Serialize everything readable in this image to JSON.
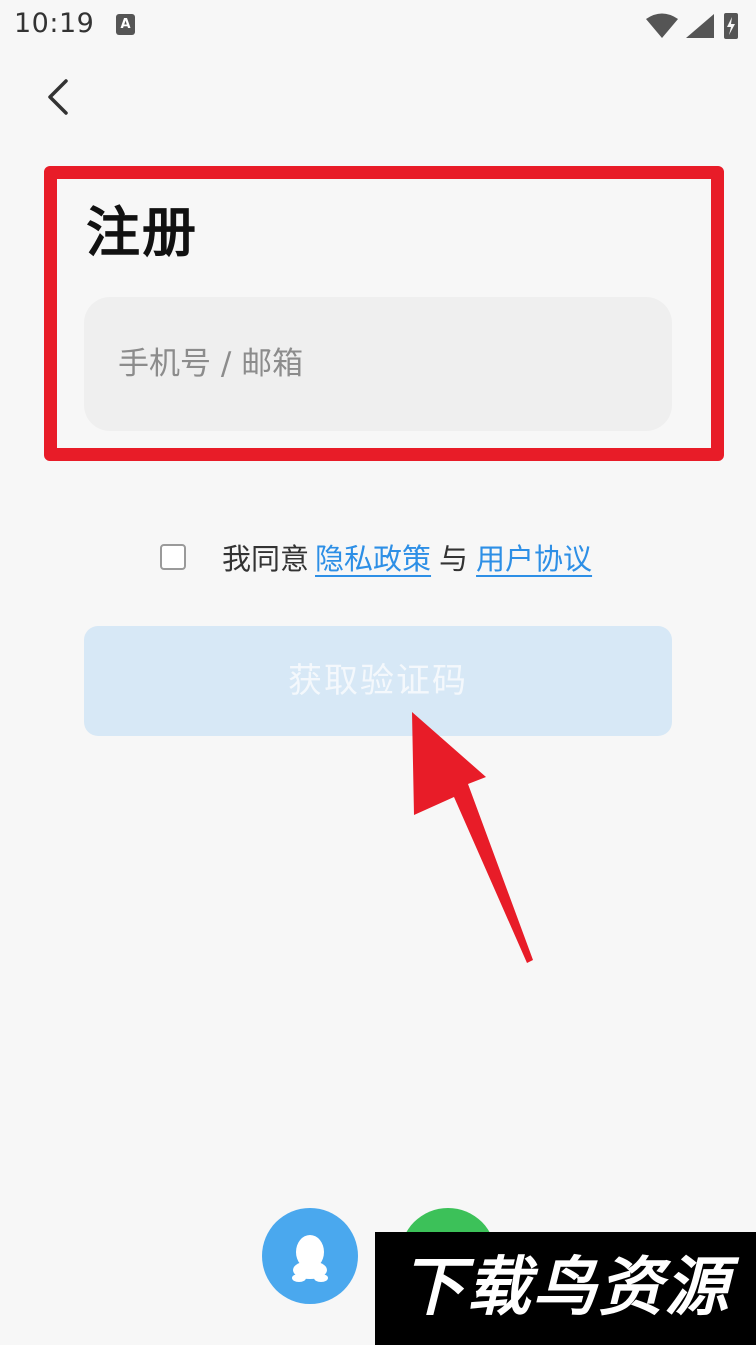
{
  "status_bar": {
    "time": "10:19",
    "notification_badge": "A",
    "icons": [
      "wifi-icon",
      "signal-icon",
      "battery-charging-icon"
    ]
  },
  "nav": {
    "back_icon": "chevron-left-icon"
  },
  "register": {
    "title": "注册",
    "account_placeholder": "手机号 / 邮箱"
  },
  "agreement": {
    "prefix": "我同意",
    "privacy_link": "隐私政策",
    "separator": "与",
    "terms_link": "用户协议"
  },
  "get_code_button": "获取验证码",
  "social_login": [
    {
      "name": "QQ",
      "icon": "qq-icon",
      "color": "#4aa8ee"
    },
    {
      "name": "WeChat",
      "icon": "wechat-icon",
      "color": "#3cc159"
    }
  ],
  "watermark": "下载鸟资源",
  "colors": {
    "background": "#f7f7f7",
    "highlight": "#e81c28",
    "link": "#2d8fe6",
    "button_disabled": "#d7e8f6"
  }
}
